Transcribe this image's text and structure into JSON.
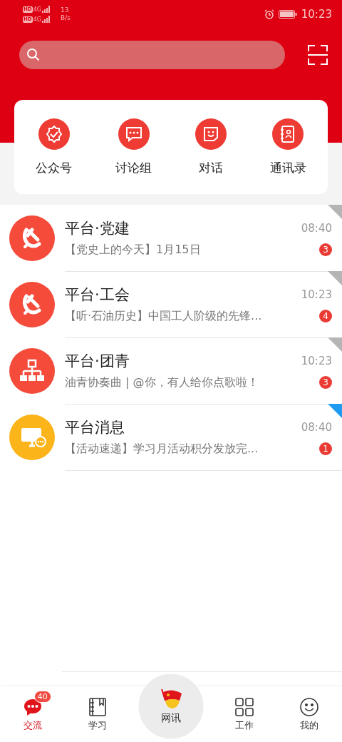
{
  "status_bar": {
    "sims": [
      {
        "badge": "HD",
        "network": "4G"
      },
      {
        "badge": "HD",
        "network": "4G"
      }
    ],
    "speed_value": "13",
    "speed_unit": "B/s",
    "time": "10:23"
  },
  "quick_actions": [
    {
      "kind": "badge",
      "label": "公众号"
    },
    {
      "kind": "chat",
      "label": "讨论组"
    },
    {
      "kind": "smile",
      "label": "对话"
    },
    {
      "kind": "contacts",
      "label": "通讯录"
    }
  ],
  "conversations": [
    {
      "kind": "emblem",
      "title": "平台·党建",
      "preview": "【党史上的今天】1月15日",
      "time": "08:40",
      "unread": "3",
      "color": "#b5b5b5"
    },
    {
      "kind": "emblem",
      "title": "平台·工会",
      "preview": "【听·石油历史】中国工人阶级的先锋...",
      "time": "10:23",
      "unread": "4",
      "color": "#b5b5b5"
    },
    {
      "kind": "org",
      "title": "平台·团青",
      "preview": "油青协奏曲 | @你，有人给你点歌啦！",
      "time": "10:23",
      "unread": "3",
      "color": "#b5b5b5"
    },
    {
      "kind": "monitor",
      "title": "平台消息",
      "preview": "【活动速递】学习月活动积分发放完...",
      "time": "08:40",
      "unread": "1",
      "color": "#1e9bf0"
    }
  ],
  "bottom_nav": [
    {
      "kind": "chat",
      "label": "交流",
      "selected": true,
      "badge": "40"
    },
    {
      "kind": "book",
      "label": "学习",
      "selected": false
    },
    {
      "kind": "flag",
      "label": "网讯",
      "selected": false
    },
    {
      "kind": "grid",
      "label": "工作",
      "selected": false
    },
    {
      "kind": "smile",
      "label": "我的",
      "selected": false
    }
  ]
}
